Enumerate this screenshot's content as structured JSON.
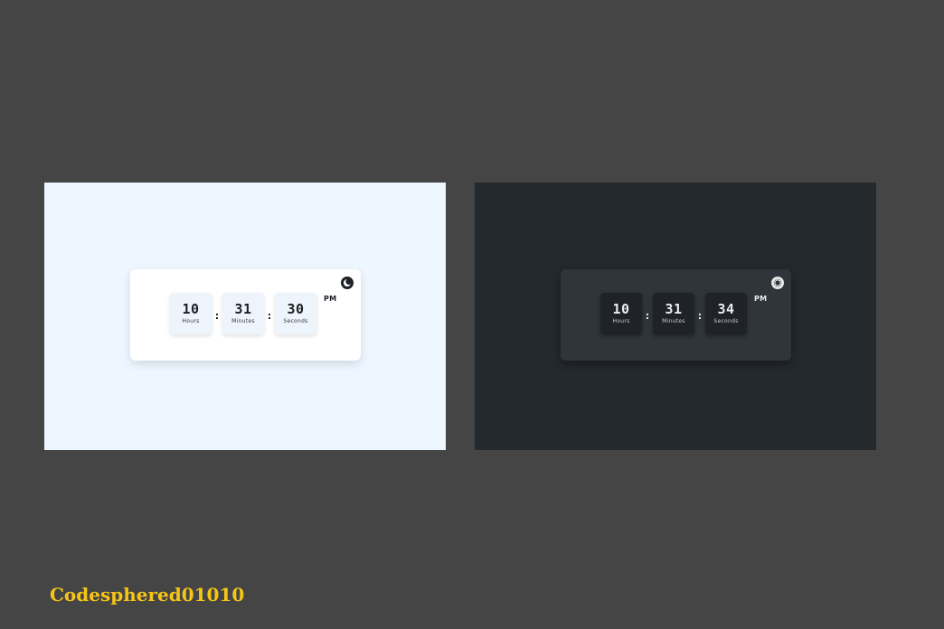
{
  "colors": {
    "page_background": "#454545",
    "light_panel": "#eef6ff",
    "dark_panel": "#24292e",
    "watermark": "#f5c518"
  },
  "light_clock": {
    "hours": "10",
    "minutes": "31",
    "seconds": "30",
    "hours_label": "Hours",
    "minutes_label": "Minutes",
    "seconds_label": "Seconds",
    "separator": ":",
    "meridiem": "PM",
    "toggle_icon": "moon-icon"
  },
  "dark_clock": {
    "hours": "10",
    "minutes": "31",
    "seconds": "34",
    "hours_label": "Hours",
    "minutes_label": "Minutes",
    "seconds_label": "Seconds",
    "separator": ":",
    "meridiem": "PM",
    "toggle_icon": "sun-icon"
  },
  "watermark": {
    "text": "Codesphered01010"
  }
}
